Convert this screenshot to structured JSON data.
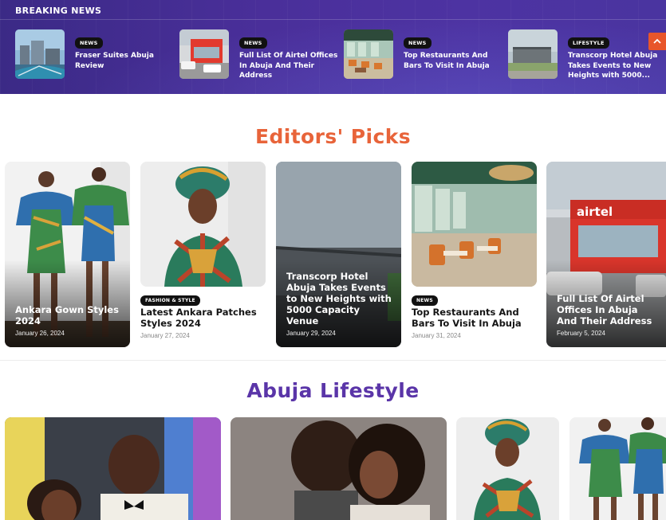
{
  "breaking": {
    "title": "BREAKING NEWS",
    "items": [
      {
        "badge": "NEWS",
        "text": "Fraser Suites Abuja Review"
      },
      {
        "badge": "NEWS",
        "text": "Full List Of Airtel Offices In Abuja And Their Address"
      },
      {
        "badge": "NEWS",
        "text": "Top Restaurants And Bars To Visit In Abuja"
      },
      {
        "badge": "LIFESTYLE",
        "text": "Transcorp Hotel Abuja Takes Events to New Heights with 5000..."
      }
    ]
  },
  "editors": {
    "title": "Editors' Picks",
    "cards": [
      {
        "title": "Ankara Gown Styles 2024",
        "date": "January 26, 2024"
      },
      {
        "badge": "FASHION & STYLE",
        "title": "Latest Ankara Patches Styles 2024",
        "date": "January 27, 2024"
      },
      {
        "title": "Transcorp Hotel Abuja Takes Events to New Heights with 5000 Capacity Venue",
        "date": "January 29, 2024"
      },
      {
        "badge": "NEWS",
        "title": "Top Restaurants And Bars To Visit In Abuja",
        "date": "January 31, 2024"
      },
      {
        "title": "Full List Of Airtel Offices In Abuja And Their Address",
        "date": "February 5, 2024"
      }
    ]
  },
  "lifestyle": {
    "title": "Abuja Lifestyle"
  },
  "icons": {
    "scroll_top": "chevron-up-icon"
  },
  "colors": {
    "accent_orange": "#e8643a",
    "accent_purple": "#5a35a8",
    "band_purple": "#4a2f9a",
    "scroll_button": "#e8562a"
  },
  "signage": {
    "airtel_logo": "airtel"
  }
}
